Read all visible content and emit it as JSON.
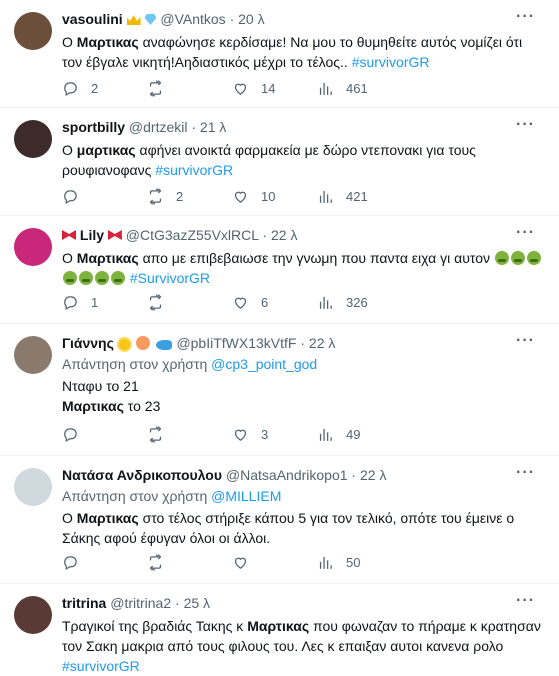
{
  "tweets": [
    {
      "name": "vasoulini",
      "handle": "@VAntkos",
      "time": "20 λ",
      "avatar_color": "#6b4f3a",
      "badges": [
        "crown",
        "diamond"
      ],
      "text_before": "Ο ",
      "bold": "Μαρτικας",
      "text_after": " αναφώνησε κερδίσαμε! Να μου το θυμηθείτε αυτός νομίζει ότι τον έβγαλε νικητή!Αηδιαστικός μέχρι το τέλος.. ",
      "hashtag": "#survivorGR",
      "replies": "2",
      "retweets": "",
      "likes": "14",
      "views": "461"
    },
    {
      "name": "sportbilly",
      "handle": "@drtzekil",
      "time": "21 λ",
      "avatar_color": "#3d2a2a",
      "text_before": "Ο ",
      "bold": "μαρτικας",
      "text_after": " αφήνει ανοικτά φαρμακεία με δώρο ντεπονακι για τους ρουφιανοφανς ",
      "hashtag": "#survivorGR",
      "replies": "",
      "retweets": "2",
      "likes": "10",
      "views": "421"
    },
    {
      "name": "Lily",
      "handle": "@CtG3azZ55VxlRCL",
      "time": "22 λ",
      "avatar_color": "#c9287a",
      "text_before": "Ο ",
      "bold": "Μαρτικας",
      "text_after": " απο με επιβεβαιωσε την γνωμη που παντα ειχα γι αυτον ",
      "hashtag": "#SurvivorGR",
      "replies": "1",
      "retweets": "",
      "likes": "6",
      "views": "326"
    },
    {
      "name": "Γιάννης",
      "handle": "@pbIiTfWX13kVtfF",
      "time": "22 λ",
      "avatar_color": "#8a7a6e",
      "reply_label": "Απάντηση στον χρήστη",
      "reply_handle": "@cp3_point_god",
      "line1": "Νταφυ το 21",
      "line2_bold": "Μαρτικας",
      "line2_rest": " το 23",
      "replies": "",
      "retweets": "",
      "likes": "3",
      "views": "49"
    },
    {
      "name": "Νατάσα Ανδρικοπουλου",
      "handle": "@NatsaAndrikopo1",
      "time": "22 λ",
      "avatar_color": "#cfd9de",
      "reply_label": "Απάντηση στον χρήστη",
      "reply_handle": "@MILLIEM",
      "text_before": "Ο ",
      "bold": "Μαρτικας",
      "text_after": " στο τέλος στήριξε κάπου 5 για τον τελικό, οπότε του έμεινε ο Σάκης αφού έφυγαν όλοι οι άλλοι.",
      "replies": "",
      "retweets": "",
      "likes": "",
      "views": "50"
    },
    {
      "name": "tritrina",
      "handle": "@tritrina2",
      "time": "25 λ",
      "avatar_color": "#5a3a34",
      "text_before": "Τραγικοί της βραδιάς Τακης κ ",
      "bold": "Μαρτικας",
      "text_after": " που φωναζαν το πήραμε κ κρατησαν τον Σακη μακρια από τους φιλους του. Λες κ επαιξαν αυτοι κανενα ρολο ",
      "hashtag": "#survivorGR"
    }
  ],
  "more_label": "···"
}
